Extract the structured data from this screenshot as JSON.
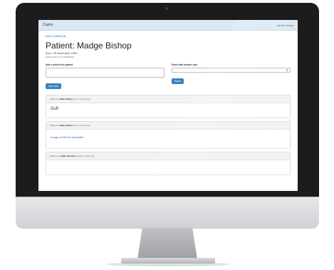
{
  "topbar": {
    "brand": "Cupris",
    "user_menu": "Admin Judge"
  },
  "back_link": "Back to patient list",
  "patient": {
    "title": "Patient: Madge Bishop",
    "born": "Born: 28 December 1964",
    "nhs": "Health System Id: 338490394"
  },
  "forms": {
    "note_label": "Add a note to this patient",
    "add_button": "Add note",
    "share_label": "Share with another user",
    "share_button": "Share"
  },
  "notes": [
    {
      "author_prefix": "Written by",
      "author": "Mike Pellett",
      "time": "about 1 month ago",
      "body": "Gulf"
    },
    {
      "author_prefix": "Written by",
      "author": "Mike Pellett",
      "time": "about 1 month ago",
      "body": "Image of left ear uploaded"
    },
    {
      "author_prefix": "Written by",
      "author": "Julian Harmans",
      "time": "about 1 month ago",
      "body": ""
    }
  ]
}
